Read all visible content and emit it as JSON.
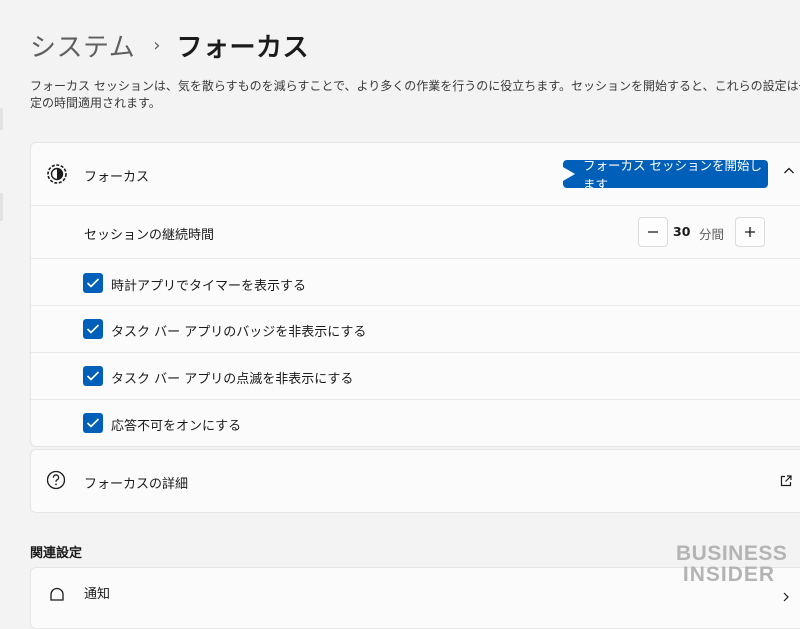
{
  "breadcrumb": {
    "parent": "システム",
    "separator": "›",
    "current": "フォーカス"
  },
  "description": "フォーカス セッションは、気を散らすものを減らすことで、より多くの作業を行うのに役立ちます。セッションを開始すると、これらの設定は一定の時間適用されます。",
  "focus": {
    "title": "フォーカス",
    "start_button": "フォーカス セッションを開始します",
    "duration": {
      "label": "セッションの継続時間",
      "value": "30",
      "unit": "分間"
    },
    "options": [
      {
        "label": "時計アプリでタイマーを表示する",
        "checked": true
      },
      {
        "label": "タスク バー アプリのバッジを非表示にする",
        "checked": true
      },
      {
        "label": "タスク バー アプリの点滅を非表示にする",
        "checked": true
      },
      {
        "label": "応答不可をオンにする",
        "checked": true
      }
    ]
  },
  "details": {
    "label": "フォーカスの詳細"
  },
  "related": {
    "title": "関連設定",
    "items": [
      {
        "label": "通知"
      }
    ]
  },
  "watermark": {
    "line1": "BUSINESS",
    "line2": "INSIDER"
  },
  "colors": {
    "accent": "#005fb8",
    "background": "#f3f3f3",
    "card": "#fbfbfb"
  }
}
